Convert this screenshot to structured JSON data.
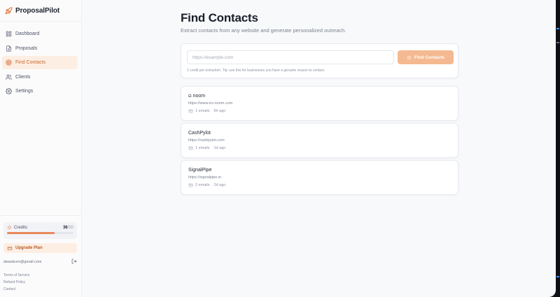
{
  "app": {
    "name": "ProposalPilot"
  },
  "sidebar": {
    "items": [
      {
        "label": "Dashboard",
        "icon": "dashboard-icon",
        "active": false
      },
      {
        "label": "Proposals",
        "icon": "document-icon",
        "active": false
      },
      {
        "label": "Find Contacts",
        "icon": "target-icon",
        "active": true
      },
      {
        "label": "Clients",
        "icon": "users-icon",
        "active": false
      },
      {
        "label": "Settings",
        "icon": "gear-icon",
        "active": false
      }
    ],
    "credits": {
      "label": "Credits",
      "value": "36",
      "total": "/50",
      "fraction": 0.72
    },
    "upgrade_label": "Upgrade Plan",
    "user_email": "dwasburn@gmail.com",
    "links": [
      "Terms of Service",
      "Refund Policy",
      "Contact"
    ]
  },
  "page": {
    "title": "Find Contacts",
    "subtitle": "Extract contacts from any website and generate personalized outreach."
  },
  "search": {
    "placeholder": "https://example.com",
    "value": "",
    "button_label": "Find Contacts",
    "hint": "1 credit per extraction. Tip: use this for businesses you have a genuine reason to contact."
  },
  "results": [
    {
      "title": "noom",
      "has_logo": true,
      "url": "https://www.eo-noom.com",
      "emails": "1 emails",
      "ago": "6h ago"
    },
    {
      "title": "CashPylot",
      "has_logo": false,
      "url": "https://cashpylot.com",
      "emails": "1 emails",
      "ago": "1d ago"
    },
    {
      "title": "SignalPipe",
      "has_logo": false,
      "url": "https://signalpipe.io",
      "emails": "2 emails",
      "ago": "2d ago"
    }
  ],
  "colors": {
    "accent": "#e9895a",
    "accent_light": "#fdeee3",
    "button": "#f4b990"
  }
}
